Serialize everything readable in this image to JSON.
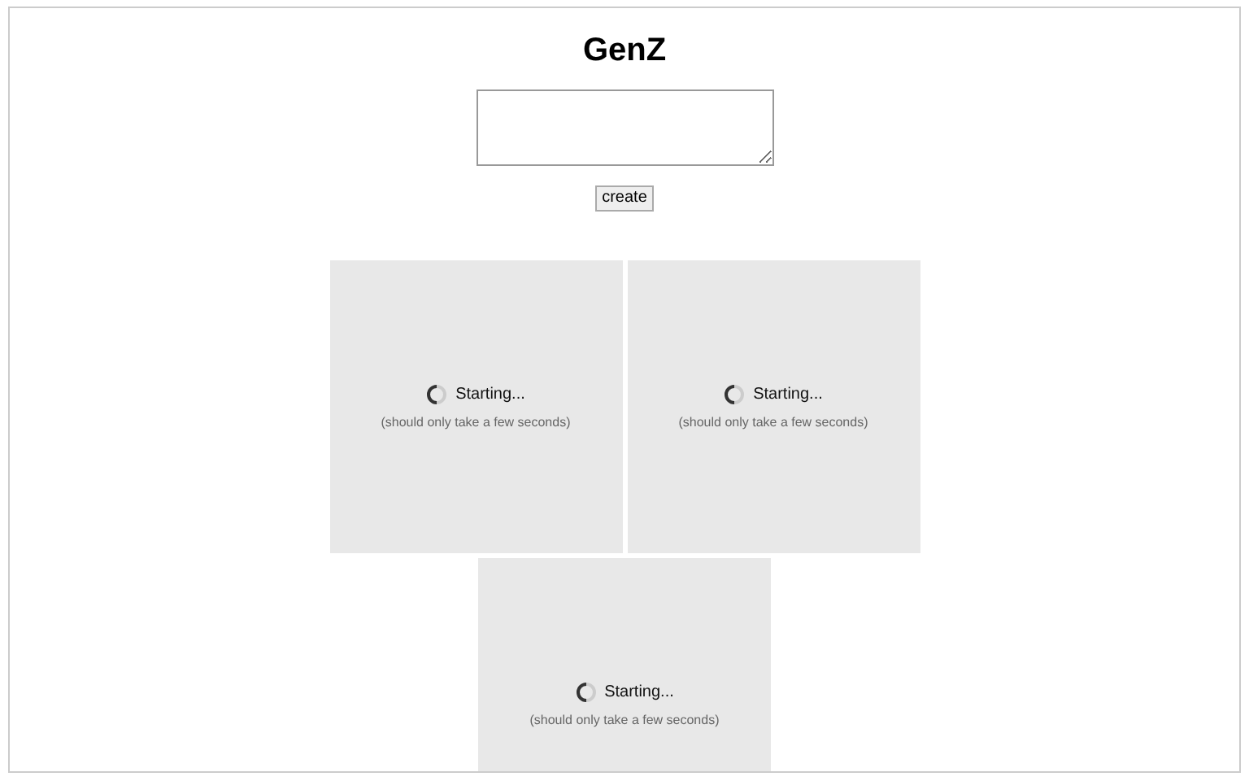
{
  "title": "GenZ",
  "create_button": "create",
  "panels": [
    {
      "status": "Starting...",
      "note": "(should only take a few seconds)"
    },
    {
      "status": "Starting...",
      "note": "(should only take a few seconds)"
    },
    {
      "status": "Starting...",
      "note": "(should only take a few seconds)"
    }
  ]
}
